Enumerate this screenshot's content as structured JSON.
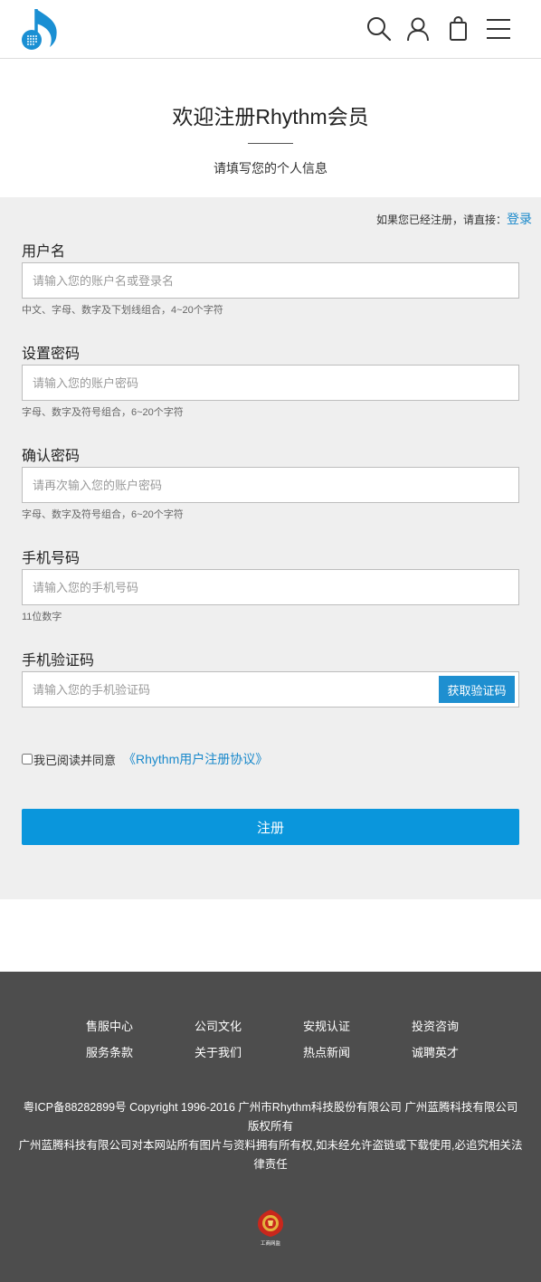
{
  "header": {
    "logo_icon": "music-note-logo-icon",
    "icons": [
      "search-icon",
      "user-icon",
      "shopping-bag-icon",
      "menu-icon"
    ]
  },
  "intro": {
    "title": "欢迎注册Rhythm会员",
    "subtitle": "请填写您的个人信息"
  },
  "form": {
    "already_text": "如果您已经注册，请直接：",
    "login_link": "登录",
    "fields": [
      {
        "label": "用户名",
        "placeholder": "请输入您的账户名或登录名",
        "hint": "中文、字母、数字及下划线组合，4~20个字符"
      },
      {
        "label": "设置密码",
        "placeholder": "请输入您的账户密码",
        "hint": "字母、数字及符号组合，6~20个字符"
      },
      {
        "label": "确认密码",
        "placeholder": "请再次输入您的账户密码",
        "hint": "字母、数字及符号组合，6~20个字符"
      },
      {
        "label": "手机号码",
        "placeholder": "请输入您的手机号码",
        "hint": "11位数字"
      },
      {
        "label": "手机验证码",
        "placeholder": "请输入您的手机验证码"
      }
    ],
    "get_code_button": "获取验证码",
    "agree_text": "我已阅读并同意",
    "agreement_link": "《Rhythm用户注册协议》",
    "submit_button": "注册"
  },
  "footer": {
    "nav": [
      [
        "售服中心",
        "公司文化",
        "安规认证",
        "投资咨询"
      ],
      [
        "服务条款",
        "关于我们",
        "热点新闻",
        "诚聘英才"
      ]
    ],
    "copyright_line1": "粤ICP备88282899号 Copyright 1996-2016 广州市Rhythm科技股份有限公司 广州蓝腾科技有限公司版权所有",
    "copyright_line2": "广州蓝腾科技有限公司对本网站所有图片与资料拥有所有权,如未经允许盗链或下载使用,必追究相关法律责任",
    "badge_text": "工商网监"
  },
  "colors": {
    "accent": "#0a96dc",
    "link": "#1a89cb",
    "form_bg": "#efefef",
    "footer_bg": "#4d4d4d"
  }
}
